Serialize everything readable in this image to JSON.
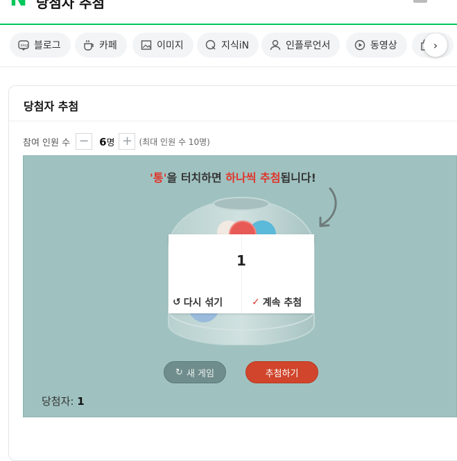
{
  "header": {
    "query": "당첨자 추첨",
    "logo": "N"
  },
  "tabs": [
    {
      "label": "블로그",
      "icon": "blog-icon"
    },
    {
      "label": "카페",
      "icon": "cafe-icon"
    },
    {
      "label": "이미지",
      "icon": "image-icon"
    },
    {
      "label": "지식iN",
      "icon": "knowledge-icon"
    },
    {
      "label": "인플루언서",
      "icon": "person-icon"
    },
    {
      "label": "동영상",
      "icon": "video-icon"
    }
  ],
  "card": {
    "title": "당첨자 추첨"
  },
  "participants": {
    "label": "참여 인원 수",
    "minus": "−",
    "value": "6",
    "unit": "명",
    "plus": "+",
    "max_note": "(최대 인원 수 10명)"
  },
  "hint": {
    "part1": "'통'",
    "part2": "을 터치하면 ",
    "part3": "하나씩 추첨",
    "part4": "됩니다!"
  },
  "result": {
    "number": "1",
    "reshuffle": "다시 섞기",
    "continue": "계속 추첨"
  },
  "buttons": {
    "new_game": "새 게임",
    "draw": "추첨하기"
  },
  "winner": {
    "label": "당첨자: ",
    "value": "1"
  },
  "colors": {
    "accent": "#03c75a",
    "stage": "#9fc2c0",
    "draw": "#d0452c",
    "red_text": "#e0342a"
  }
}
